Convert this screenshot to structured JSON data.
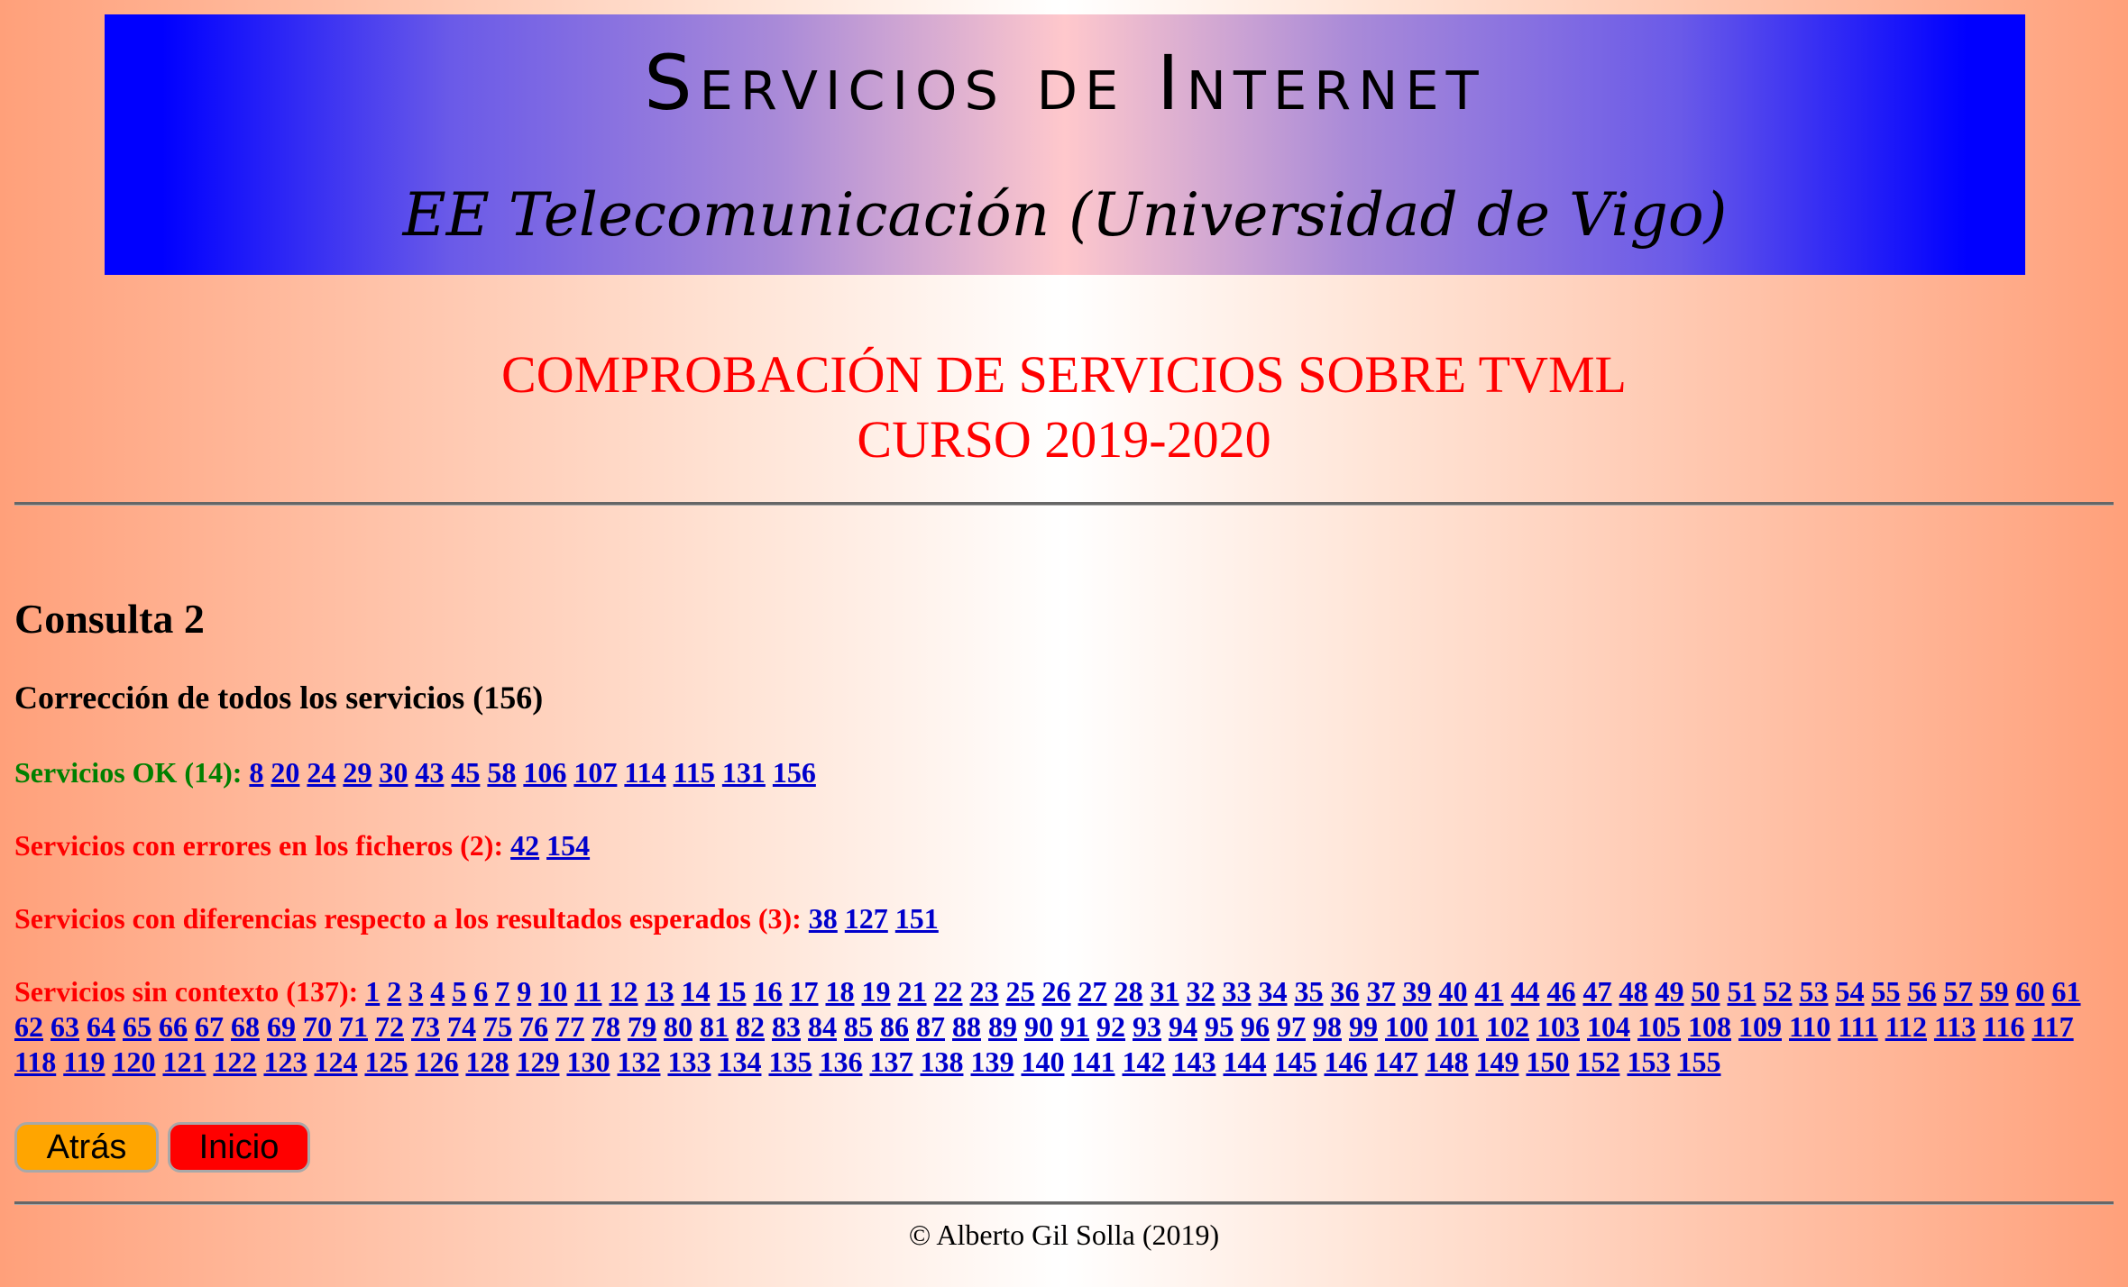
{
  "banner": {
    "title": "Servicios de Internet",
    "subtitle": "EE Telecomunicación (Universidad de Vigo)"
  },
  "heading": {
    "line1": "COMPROBACIÓN DE SERVICIOS SOBRE TVML",
    "line2": "CURSO 2019-2020"
  },
  "consulta": {
    "title": "Consulta 2",
    "subtitle": "Corrección de todos los servicios (156)"
  },
  "groups": {
    "ok": {
      "label": "Servicios OK (14):",
      "items": [
        "8",
        "20",
        "24",
        "29",
        "30",
        "43",
        "45",
        "58",
        "106",
        "107",
        "114",
        "115",
        "131",
        "156"
      ]
    },
    "errors": {
      "label": "Servicios con errores en los ficheros (2):",
      "items": [
        "42",
        "154"
      ]
    },
    "diffs": {
      "label": "Servicios con diferencias respecto a los resultados esperados (3):",
      "items": [
        "38",
        "127",
        "151"
      ]
    },
    "nocontext": {
      "label": "Servicios sin contexto (137):",
      "items": [
        "1",
        "2",
        "3",
        "4",
        "5",
        "6",
        "7",
        "9",
        "10",
        "11",
        "12",
        "13",
        "14",
        "15",
        "16",
        "17",
        "18",
        "19",
        "21",
        "22",
        "23",
        "25",
        "26",
        "27",
        "28",
        "31",
        "32",
        "33",
        "34",
        "35",
        "36",
        "37",
        "39",
        "40",
        "41",
        "44",
        "46",
        "47",
        "48",
        "49",
        "50",
        "51",
        "52",
        "53",
        "54",
        "55",
        "56",
        "57",
        "59",
        "60",
        "61",
        "62",
        "63",
        "64",
        "65",
        "66",
        "67",
        "68",
        "69",
        "70",
        "71",
        "72",
        "73",
        "74",
        "75",
        "76",
        "77",
        "78",
        "79",
        "80",
        "81",
        "82",
        "83",
        "84",
        "85",
        "86",
        "87",
        "88",
        "89",
        "90",
        "91",
        "92",
        "93",
        "94",
        "95",
        "96",
        "97",
        "98",
        "99",
        "100",
        "101",
        "102",
        "103",
        "104",
        "105",
        "108",
        "109",
        "110",
        "111",
        "112",
        "113",
        "116",
        "117",
        "118",
        "119",
        "120",
        "121",
        "122",
        "123",
        "124",
        "125",
        "126",
        "128",
        "129",
        "130",
        "132",
        "133",
        "134",
        "135",
        "136",
        "137",
        "138",
        "139",
        "140",
        "141",
        "142",
        "143",
        "144",
        "145",
        "146",
        "147",
        "148",
        "149",
        "150",
        "152",
        "153",
        "155"
      ]
    }
  },
  "buttons": {
    "back": "Atrás",
    "home": "Inicio"
  },
  "footer": {
    "text": "© Alberto Gil Solla (2019)"
  },
  "colors": {
    "banner_edge": "#0000ff",
    "heading": "#ff0000",
    "ok_label": "#008000",
    "link": "#0000cc",
    "back_button": "#ffa500",
    "home_button": "#ff0000"
  }
}
